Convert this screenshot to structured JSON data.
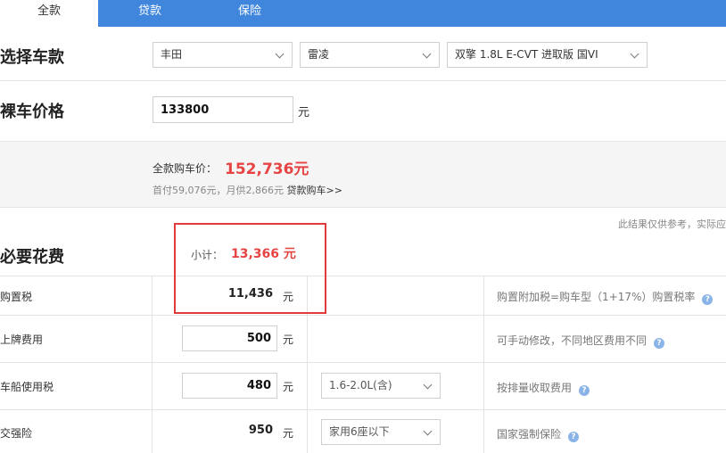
{
  "tabs": [
    {
      "label": "全款",
      "active": true
    },
    {
      "label": "贷款",
      "active": false
    },
    {
      "label": "保险",
      "active": false
    }
  ],
  "select_car": {
    "title": "选择车款",
    "brand": "丰田",
    "series": "雷凌",
    "model": "双擎 1.8L E-CVT 进取版 国VI"
  },
  "bare_price": {
    "title": "裸车价格",
    "value": "133800",
    "unit": "元"
  },
  "summary": {
    "label": "全款购车价：",
    "value": "152,736元",
    "sub_text": "首付59,076元，月供2,866元 ",
    "loan_link": "贷款购车>>"
  },
  "disclaimer": "此结果仅供参考，实际应",
  "required_fees": {
    "title": "必要花费",
    "subtotal_label": "小计：",
    "subtotal_value": "13,366 元",
    "items": [
      {
        "label": "购置税",
        "value": "11,436",
        "unit": "元",
        "note": "购置附加税=购车型（1+17%）购置税率"
      },
      {
        "label": "上牌费用",
        "value": "500",
        "unit": "元",
        "note": "可手动修改，不同地区费用不同"
      },
      {
        "label": "车船使用税",
        "value": "480",
        "unit": "元",
        "option": "1.6-2.0L(含)",
        "note": "按排量收取费用"
      },
      {
        "label": "交强险",
        "value": "950",
        "unit": "元",
        "option": "家用6座以下",
        "note": "国家强制保险"
      }
    ]
  },
  "help_icon_glyph": "?",
  "colors": {
    "tab_blue": "#3f86dc",
    "price_red": "#e64343",
    "highlight_red": "#e23b3b",
    "help_icon": "#8ab4e8"
  }
}
